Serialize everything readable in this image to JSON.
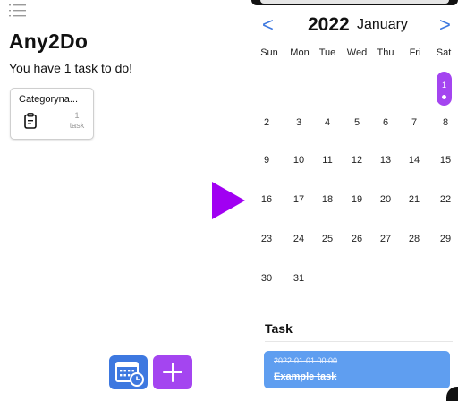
{
  "app": {
    "title": "Any2Do",
    "subtitle": "You have 1 task to do!"
  },
  "category": {
    "name": "Categoryna...",
    "count": "1",
    "count_unit": "task"
  },
  "toolbar": {
    "calendar_icon": "calendar-clock-icon",
    "add_icon": "plus-icon"
  },
  "calendar": {
    "year": "2022",
    "month": "January",
    "prev_label": "<",
    "next_label": ">",
    "weekdays": [
      "Sun",
      "Mon",
      "Tue",
      "Wed",
      "Thu",
      "Fri",
      "Sat"
    ],
    "selected_day": "1",
    "weeks": [
      [
        "",
        "",
        "",
        "",
        "",
        "",
        "1"
      ],
      [
        "2",
        "3",
        "4",
        "5",
        "6",
        "7",
        "8"
      ],
      [
        "9",
        "10",
        "11",
        "12",
        "13",
        "14",
        "15"
      ],
      [
        "16",
        "17",
        "18",
        "19",
        "20",
        "21",
        "22"
      ],
      [
        "23",
        "24",
        "25",
        "26",
        "27",
        "28",
        "29"
      ],
      [
        "30",
        "31",
        "",
        "",
        "",
        "",
        ""
      ]
    ]
  },
  "tasks": {
    "heading": "Task",
    "items": [
      {
        "time": "2022-01-01 00:00",
        "title": "Example task"
      }
    ]
  },
  "colors": {
    "accent_purple": "#a445f0",
    "accent_blue": "#3d78e0",
    "task_card": "#5f9ef0"
  }
}
